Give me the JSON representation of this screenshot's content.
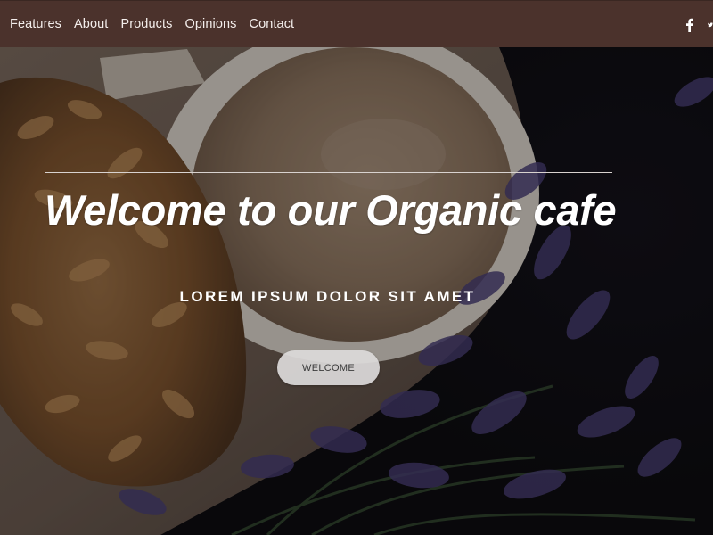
{
  "nav": {
    "links": [
      "Features",
      "About",
      "Products",
      "Opinions",
      "Contact"
    ],
    "social": [
      "facebook-icon",
      "twitter-icon"
    ]
  },
  "hero": {
    "title": "Welcome to our Organic cafe",
    "subtitle": "LOREM IPSUM DOLOR SIT AMET",
    "button_label": "WELCOME"
  },
  "colors": {
    "navbar": "#4b322c",
    "nav_text": "#f4eeec",
    "button_bg": "#dcdada"
  }
}
